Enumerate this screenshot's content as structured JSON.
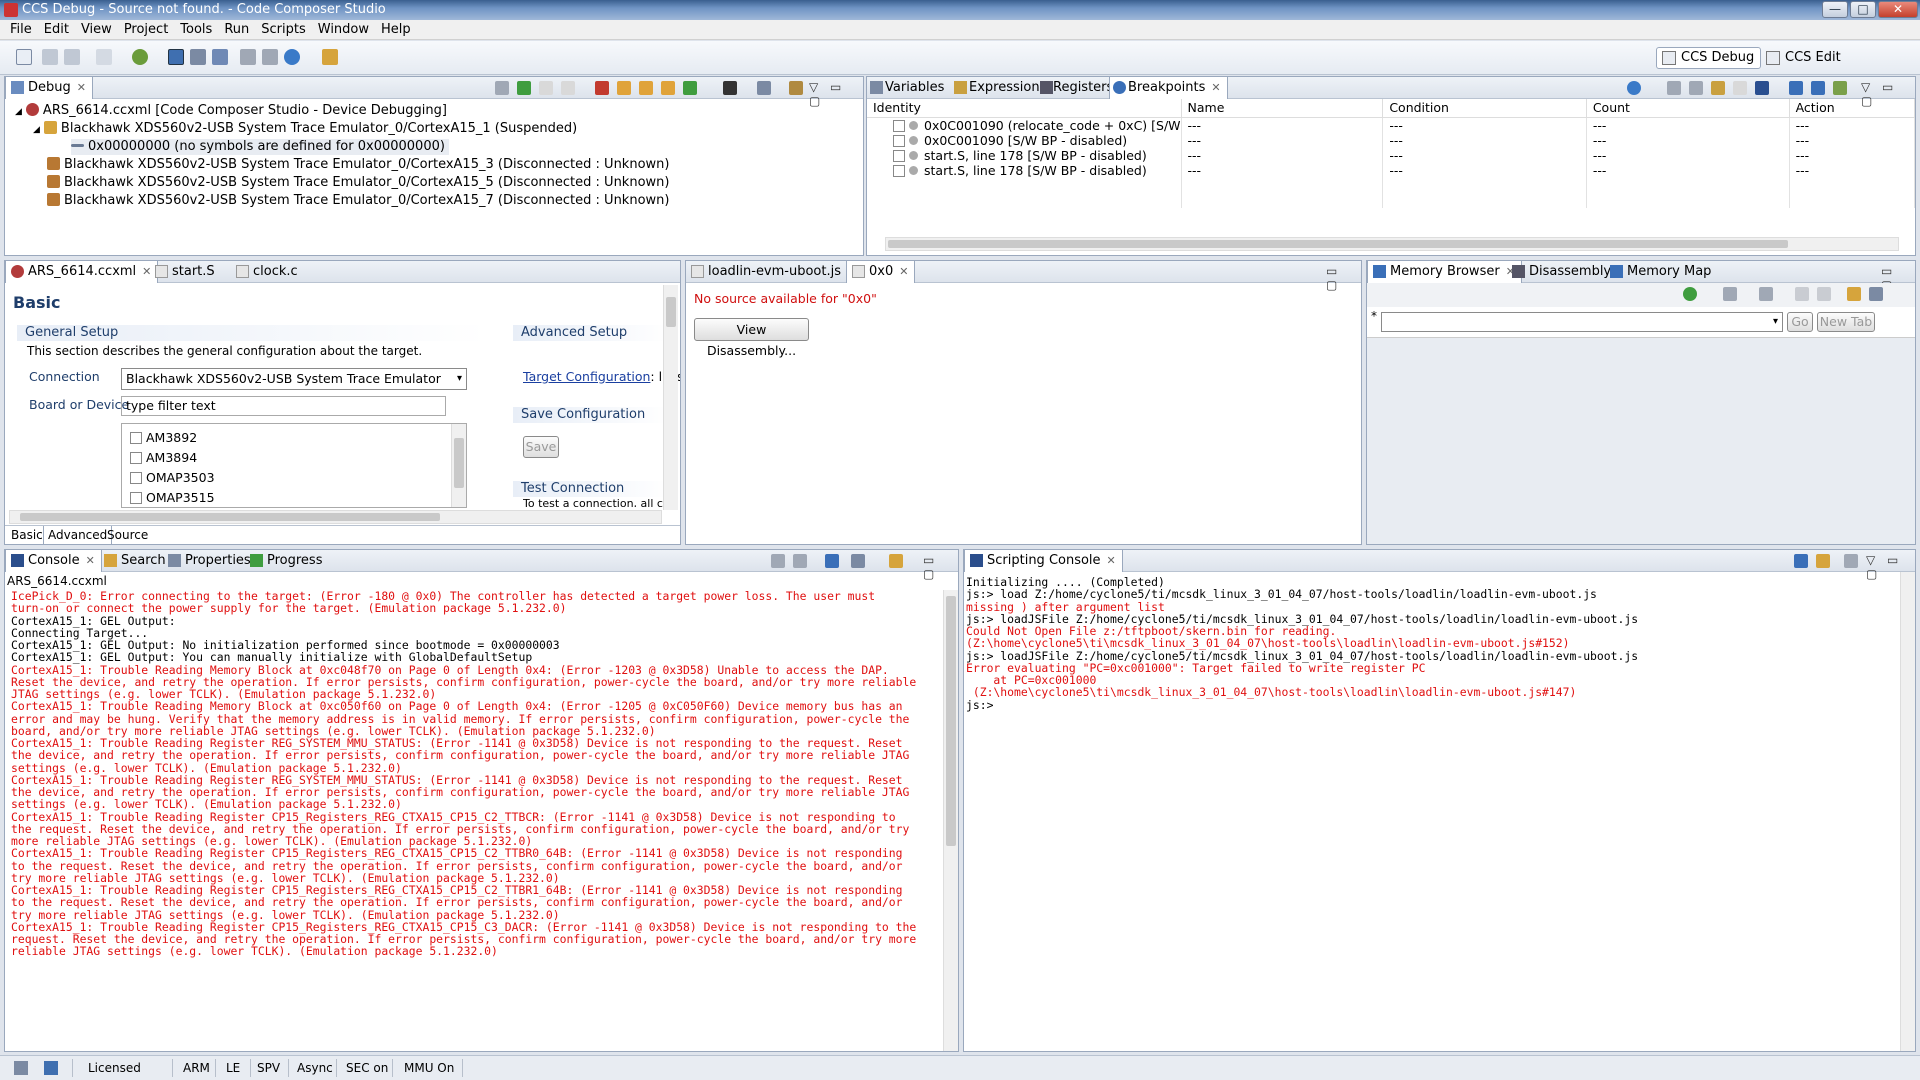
{
  "window": {
    "title": "CCS Debug - Source not found. - Code Composer Studio",
    "controls": [
      "—",
      "□",
      "✕"
    ]
  },
  "menu": [
    "File",
    "Edit",
    "View",
    "Project",
    "Tools",
    "Run",
    "Scripts",
    "Window",
    "Help"
  ],
  "perspectives": {
    "debug": "CCS Debug",
    "edit": "CCS Edit"
  },
  "debug_view": {
    "tab": "Debug",
    "tree": [
      "ARS_6614.ccxml [Code Composer Studio - Device Debugging]",
      "Blackhawk XDS560v2-USB System Trace Emulator_0/CortexA15_1 (Suspended)",
      "0x00000000  (no symbols are defined for 0x00000000)",
      "Blackhawk XDS560v2-USB System Trace Emulator_0/CortexA15_3 (Disconnected : Unknown)",
      "Blackhawk XDS560v2-USB System Trace Emulator_0/CortexA15_5 (Disconnected : Unknown)",
      "Blackhawk XDS560v2-USB System Trace Emulator_0/CortexA15_7 (Disconnected : Unknown)"
    ]
  },
  "bp_view": {
    "tabs": [
      "Variables",
      "Expressions",
      "Registers",
      "Breakpoints"
    ],
    "columns": [
      "Identity",
      "Name",
      "Condition",
      "Count",
      "Action"
    ],
    "rows": [
      {
        "identity": "0x0C001090 (relocate_code + 0xC)  [S/W",
        "name": "---",
        "condition": "---",
        "count": "---",
        "action": "---"
      },
      {
        "identity": "0x0C001090 [S/W BP - disabled)",
        "name": "---",
        "condition": "---",
        "count": "---",
        "action": "---"
      },
      {
        "identity": "start.S, line 178 [S/W BP - disabled)",
        "name": "---",
        "condition": "---",
        "count": "---",
        "action": "---"
      },
      {
        "identity": "start.S, line 178 [S/W BP - disabled)",
        "name": "---",
        "condition": "---",
        "count": "---",
        "action": "---"
      }
    ]
  },
  "editor": {
    "tabs": [
      "ARS_6614.ccxml",
      "start.S",
      "clock.c"
    ],
    "heading": "Basic",
    "general_setup": "General Setup",
    "general_desc": "This section describes the general configuration about the target.",
    "connection_label": "Connection",
    "connection_value": "Blackhawk XDS560v2-USB System Trace Emulator",
    "board_label": "Board or Device",
    "filter_placeholder": "type filter text",
    "devices": [
      "AM3892",
      "AM3894",
      "OMAP3503",
      "OMAP3515"
    ],
    "advanced_setup": "Advanced Setup",
    "target_config_link": "Target Configuration",
    "target_config_rest": ": lists",
    "save_config": "Save Configuration",
    "save_button": "Save",
    "test_connection": "Test Connection",
    "test_connection_rest": "To test a connection, all ch",
    "bottom_tabs": [
      "Basic",
      "Advanced",
      "Source"
    ]
  },
  "source_view": {
    "tabs": [
      "loadlin-evm-uboot.js",
      "0x0"
    ],
    "message": "No source available for \"0x0\"",
    "button": "View Disassembly..."
  },
  "memory_view": {
    "tabs": [
      "Memory Browser",
      "Disassembly",
      "Memory Map"
    ],
    "address_placeholder": "*",
    "go_button": "Go",
    "newtab_button": "New Tab"
  },
  "console_view": {
    "tabs": [
      "Console",
      "Search",
      "Properties",
      "Progress"
    ],
    "title": "ARS_6614.ccxml",
    "lines": [
      {
        "t": "IcePick_D_0: Error connecting to the target: (Error -180 @ 0x0) The controller has detected a target power loss. The user must",
        "e": true
      },
      {
        "t": "turn-on or connect the power supply for the target. (Emulation package 5.1.232.0)",
        "e": true
      },
      {
        "t": "CortexA15_1: GEL Output:",
        "e": false
      },
      {
        "t": "Connecting Target...",
        "e": false
      },
      {
        "t": "CortexA15_1: GEL Output: No initialization performed since bootmode = 0x00000003",
        "e": false
      },
      {
        "t": "CortexA15_1: GEL Output: You can manually initialize with GlobalDefaultSetup",
        "e": false
      },
      {
        "t": "CortexA15_1: Trouble Reading Memory Block at 0xc048f70 on Page 0 of Length 0x4: (Error -1203 @ 0x3D58) Unable to access the DAP.",
        "e": true
      },
      {
        "t": "Reset the device, and retry the operation. If error persists, confirm configuration, power-cycle the board, and/or try more reliable",
        "e": true
      },
      {
        "t": "JTAG settings (e.g. lower TCLK). (Emulation package 5.1.232.0)",
        "e": true
      },
      {
        "t": "CortexA15_1: Trouble Reading Memory Block at 0xc050f60 on Page 0 of Length 0x4: (Error -1205 @ 0xC050F60) Device memory bus has an",
        "e": true
      },
      {
        "t": "error and may be hung. Verify that the memory address is in valid memory. If error persists, confirm configuration, power-cycle the",
        "e": true
      },
      {
        "t": "board, and/or try more reliable JTAG settings (e.g. lower TCLK). (Emulation package 5.1.232.0)",
        "e": true
      },
      {
        "t": "CortexA15_1: Trouble Reading Register REG_SYSTEM_MMU_STATUS: (Error -1141 @ 0x3D58) Device is not responding to the request. Reset",
        "e": true
      },
      {
        "t": "the device, and retry the operation. If error persists, confirm configuration, power-cycle the board, and/or try more reliable JTAG",
        "e": true
      },
      {
        "t": "settings (e.g. lower TCLK). (Emulation package 5.1.232.0)",
        "e": true
      },
      {
        "t": "CortexA15_1: Trouble Reading Register REG_SYSTEM_MMU_STATUS: (Error -1141 @ 0x3D58) Device is not responding to the request. Reset",
        "e": true
      },
      {
        "t": "the device, and retry the operation. If error persists, confirm configuration, power-cycle the board, and/or try more reliable JTAG",
        "e": true
      },
      {
        "t": "settings (e.g. lower TCLK). (Emulation package 5.1.232.0)",
        "e": true
      },
      {
        "t": "CortexA15_1: Trouble Reading Register CP15_Registers_REG_CTXA15_CP15_C2_TTBCR: (Error -1141 @ 0x3D58) Device is not responding to",
        "e": true
      },
      {
        "t": "the request. Reset the device, and retry the operation. If error persists, confirm configuration, power-cycle the board, and/or try",
        "e": true
      },
      {
        "t": "more reliable JTAG settings (e.g. lower TCLK). (Emulation package 5.1.232.0)",
        "e": true
      },
      {
        "t": "CortexA15_1: Trouble Reading Register CP15_Registers_REG_CTXA15_CP15_C2_TTBR0_64B: (Error -1141 @ 0x3D58) Device is not responding",
        "e": true
      },
      {
        "t": "to the request. Reset the device, and retry the operation. If error persists, confirm configuration, power-cycle the board, and/or",
        "e": true
      },
      {
        "t": "try more reliable JTAG settings (e.g. lower TCLK). (Emulation package 5.1.232.0)",
        "e": true
      },
      {
        "t": "CortexA15_1: Trouble Reading Register CP15_Registers_REG_CTXA15_CP15_C2_TTBR1_64B: (Error -1141 @ 0x3D58) Device is not responding",
        "e": true
      },
      {
        "t": "to the request. Reset the device, and retry the operation. If error persists, confirm configuration, power-cycle the board, and/or",
        "e": true
      },
      {
        "t": "try more reliable JTAG settings (e.g. lower TCLK). (Emulation package 5.1.232.0)",
        "e": true
      },
      {
        "t": "CortexA15_1: Trouble Reading Register CP15_Registers_REG_CTXA15_CP15_C3_DACR: (Error -1141 @ 0x3D58) Device is not responding to the",
        "e": true
      },
      {
        "t": "request. Reset the device, and retry the operation. If error persists, confirm configuration, power-cycle the board, and/or try more",
        "e": true
      },
      {
        "t": "reliable JTAG settings (e.g. lower TCLK). (Emulation package 5.1.232.0)",
        "e": true
      }
    ]
  },
  "script_view": {
    "tab": "Scripting Console",
    "lines": [
      {
        "t": "Initializing .... (Completed)",
        "e": false
      },
      {
        "t": "",
        "e": false
      },
      {
        "t": "js:> load Z:/home/cyclone5/ti/mcsdk_linux_3_01_04_07/host-tools/loadlin/loadlin-evm-uboot.js",
        "e": false
      },
      {
        "t": "missing ) after argument list",
        "e": true
      },
      {
        "t": "js:> loadJSFile Z:/home/cyclone5/ti/mcsdk_linux_3_01_04_07/host-tools/loadlin/loadlin-evm-uboot.js",
        "e": false
      },
      {
        "t": "Could Not Open File z:/tftpboot/skern.bin for reading.",
        "e": true
      },
      {
        "t": "(Z:\\home\\cyclone5\\ti\\mcsdk_linux_3_01_04_07\\host-tools\\loadlin\\loadlin-evm-uboot.js#152)",
        "e": true
      },
      {
        "t": "js:> loadJSFile Z:/home/cyclone5/ti/mcsdk_linux_3_01_04_07/host-tools/loadlin/loadlin-evm-uboot.js",
        "e": false
      },
      {
        "t": "Error evaluating \"PC=0xc001000\": Target failed to write register PC",
        "e": true
      },
      {
        "t": "    at PC=0xc001000",
        "e": true
      },
      {
        "t": " (Z:\\home\\cyclone5\\ti\\mcsdk_linux_3_01_04_07\\host-tools\\loadlin\\loadlin-evm-uboot.js#147)",
        "e": true
      },
      {
        "t": "js:>",
        "e": false
      }
    ]
  },
  "status": {
    "licensed": "Licensed",
    "items": [
      "ARM",
      "LE",
      "SPV",
      "Async",
      "SEC on",
      "MMU On"
    ]
  }
}
